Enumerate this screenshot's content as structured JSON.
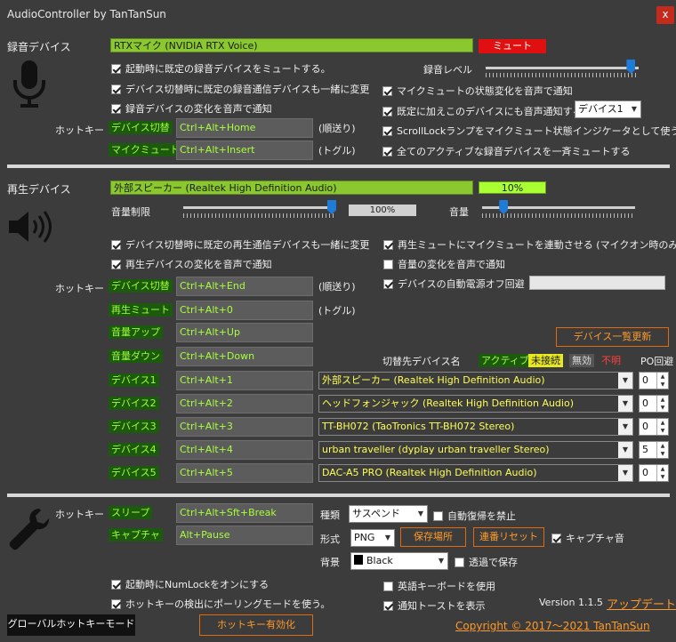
{
  "window": {
    "title": "AudioController by TanTanSun",
    "close": "x"
  },
  "rec": {
    "section_label": "録音デバイス",
    "device": "RTXマイク (NVIDIA RTX Voice)",
    "status": "ミュート",
    "level_label": "録音レベル",
    "level": 0.95,
    "left_checks": [
      {
        "label": "起動時に既定の録音デバイスをミュートする。",
        "checked": true
      },
      {
        "label": "デバイス切替時に既定の録音通信デバイスも一緒に変更",
        "checked": true
      },
      {
        "label": "録音デバイスの変化を音声で通知",
        "checked": true
      }
    ],
    "right_checks": [
      {
        "label": "マイクミュートの状態変化を音声で通知",
        "checked": true
      },
      {
        "label": "既定に加えこのデバイスにも音声通知する",
        "checked": true
      },
      {
        "label": "ScrollLockランプをマイクミュート状態インジケータとして使う",
        "checked": true
      },
      {
        "label": "全てのアクティブな録音デバイスを一斉ミュートする",
        "checked": true
      }
    ],
    "notify_device": "デバイス1",
    "hotkey_label": "ホットキー",
    "hotkeys": [
      {
        "name": "デバイス切替",
        "key": "Ctrl+Alt+Home",
        "note": "(順送り)"
      },
      {
        "name": "マイクミュート",
        "key": "Ctrl+Alt+Insert",
        "note": "(トグル)"
      }
    ]
  },
  "play": {
    "section_label": "再生デバイス",
    "device": "外部スピーカー (Realtek High Definition Audio)",
    "level_text": "10%",
    "limit_label": "音量制限",
    "limit_value": "100%",
    "limit": 1.0,
    "volume_label": "音量",
    "volume": 0.1,
    "left_checks": [
      {
        "label": "デバイス切替時に既定の再生通信デバイスも一緒に変更",
        "checked": true
      },
      {
        "label": "再生デバイスの変化を音声で通知",
        "checked": true
      }
    ],
    "right_checks": [
      {
        "label": "再生ミュートにマイクミュートを連動させる (マイクオン時のみ)",
        "checked": true
      },
      {
        "label": "音量の変化を音声で通知",
        "checked": false
      },
      {
        "label": "デバイスの自動電源オフ回避",
        "checked": true
      }
    ],
    "hotkey_label": "ホットキー",
    "hotkeys": [
      {
        "name": "デバイス切替",
        "key": "Ctrl+Alt+End",
        "note": "(順送り)"
      },
      {
        "name": "再生ミュート",
        "key": "Ctrl+Alt+0",
        "note": "(トグル)"
      },
      {
        "name": "音量アップ",
        "key": "Ctrl+Alt+Up",
        "note": ""
      },
      {
        "name": "音量ダウン",
        "key": "Ctrl+Alt+Down",
        "note": ""
      }
    ],
    "refresh_button": "デバイス一覧更新",
    "target_header": "切替先デバイス名",
    "legend": [
      {
        "label": "アクティブ",
        "fg": "#9eff3a",
        "bg": "#1c5a0e"
      },
      {
        "label": "未接続",
        "fg": "#1a1a1a",
        "bg": "#e8e820"
      },
      {
        "label": "無効",
        "fg": "#dddddd",
        "bg": "#555555"
      },
      {
        "label": "不明",
        "fg": "#ff4040",
        "bg": "#3c3c3c"
      }
    ],
    "po_label": "PO回避",
    "devices": [
      {
        "name": "デバイス1",
        "key": "Ctrl+Alt+1",
        "target": "外部スピーカー (Realtek High Definition Audio)",
        "po": "0"
      },
      {
        "name": "デバイス2",
        "key": "Ctrl+Alt+2",
        "target": "ヘッドフォンジャック (Realtek High Definition Audio)",
        "po": "0"
      },
      {
        "name": "デバイス3",
        "key": "Ctrl+Alt+3",
        "target": "TT-BH072 (TaoTronics TT-BH072 Stereo)",
        "po": "0"
      },
      {
        "name": "デバイス4",
        "key": "Ctrl+Alt+4",
        "target": "urban traveller (dyplay urban traveller Stereo)",
        "po": "5"
      },
      {
        "name": "デバイス5",
        "key": "Ctrl+Alt+5",
        "target": "DAC-A5 PRO (Realtek High Definition Audio)",
        "po": "0"
      }
    ]
  },
  "misc": {
    "hotkey_label": "ホットキー",
    "hotkeys": [
      {
        "name": "スリープ",
        "key": "Ctrl+Alt+Sft+Break"
      },
      {
        "name": "キャプチャ",
        "key": "Alt+Pause"
      }
    ],
    "kind_label": "種類",
    "kind_value": "サスペンド",
    "no_autowake": {
      "label": "自動復帰を禁止",
      "checked": false
    },
    "format_label": "形式",
    "format_value": "PNG",
    "save_location": "保存場所",
    "serial_reset": "連番リセット",
    "capture_sound": {
      "label": "キャプチャ音",
      "checked": true
    },
    "bg_label": "背景",
    "bg_value": "Black",
    "transparent_save": {
      "label": "透過で保存",
      "checked": false
    },
    "numlock": {
      "label": "起動時にNumLockをオンにする",
      "checked": true
    },
    "polling": {
      "label": "ホットキーの検出にポーリングモードを使う。",
      "checked": true
    },
    "eng_kb": {
      "label": "英語キーボードを使用",
      "checked": false
    },
    "toast": {
      "label": "通知トーストを表示",
      "checked": true
    },
    "version": "Version 1.1.5",
    "update": "アップデート",
    "global_mode": "グローバルホットキーモード",
    "hotkey_enable": "ホットキー有効化",
    "copyright": "Copyright © 2017～2021 TanTanSun"
  }
}
